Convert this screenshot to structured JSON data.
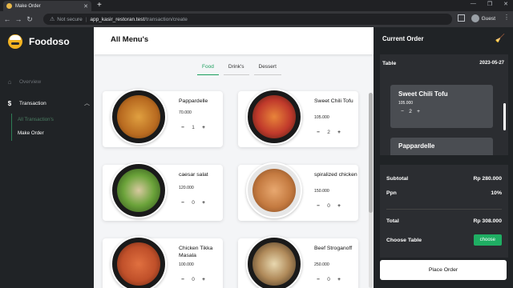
{
  "browser": {
    "tab_title": "Make Order",
    "security": "Not secure",
    "url_host": "app_kasir_restoran.test",
    "url_path": "/transaction/create",
    "profile": "Guest"
  },
  "sidebar": {
    "brand": "Foodoso",
    "items": [
      {
        "label": "Overview",
        "icon": "home-icon"
      },
      {
        "label": "Transaction",
        "icon": "dollar-icon"
      }
    ],
    "sub_items": [
      "All Transaction's",
      "Make Order"
    ]
  },
  "main": {
    "title": "All Menu's",
    "tabs": [
      "Food",
      "Drink's",
      "Dessert"
    ],
    "active_tab": "Food",
    "foods": [
      {
        "name": "Pappardelle",
        "price": "70.000",
        "qty": "1",
        "color": "#c07a2a"
      },
      {
        "name": "Sweet Chili Tofu",
        "price": "105.000",
        "qty": "2",
        "color": "#c0392b"
      },
      {
        "name": "caesar salat",
        "price": "120.000",
        "qty": "0",
        "color": "#6ba33a"
      },
      {
        "name": "spiralized chicken",
        "price": "150.000",
        "qty": "0",
        "color": "#d08a4f"
      },
      {
        "name": "Chicken Tikka Masala",
        "price": "100.000",
        "qty": "0",
        "color": "#c0502a"
      },
      {
        "name": "Beef Stroganoff",
        "price": "250.000",
        "qty": "0",
        "color": "#b08a5a"
      }
    ]
  },
  "order": {
    "title": "Current Order",
    "table_label": "Table",
    "date": "2023-05-27",
    "items": [
      {
        "name": "Sweet Chili Tofu",
        "price": "105.000",
        "qty": "2"
      },
      {
        "name": "Pappardelle"
      }
    ],
    "subtotal_label": "Subtotal",
    "subtotal": "Rp 280.000",
    "ppn_label": "Ppn",
    "ppn": "10%",
    "total_label": "Total",
    "total": "Rp 308.000",
    "choose_table_label": "Choose Table",
    "choose_button": "choose",
    "place_order": "Place Order"
  },
  "colors": {
    "accent_green": "#1fae63",
    "sidebar_bg": "#202326",
    "main_bg": "#f4f5f7"
  }
}
